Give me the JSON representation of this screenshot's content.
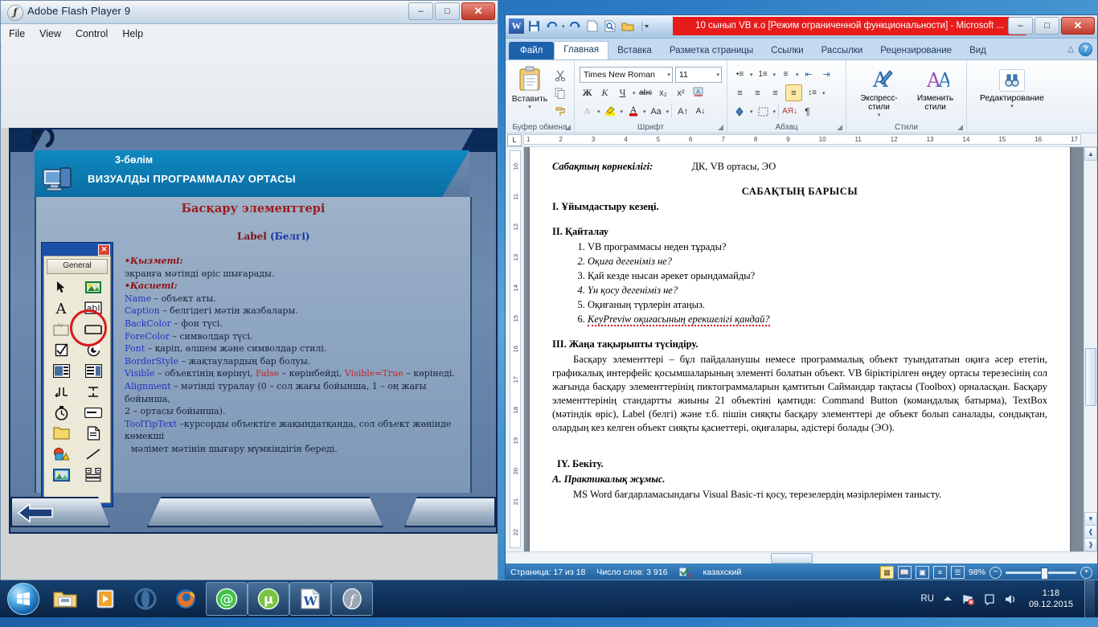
{
  "desktop": {
    "taskbar": {
      "start_label": "start-orb",
      "items": [
        {
          "name": "explorer",
          "label": "Windows Explorer"
        },
        {
          "name": "media-player",
          "label": "Windows Media Player"
        },
        {
          "name": "opera",
          "label": "Opera"
        },
        {
          "name": "firefox",
          "label": "Mozilla Firefox"
        },
        {
          "name": "icq",
          "label": "ICQ"
        },
        {
          "name": "utorrent",
          "label": "uTorrent"
        },
        {
          "name": "word",
          "label": "Microsoft Word"
        },
        {
          "name": "flash",
          "label": "Adobe Flash Player"
        }
      ],
      "tray": {
        "language": "RU",
        "time": "1:18",
        "date": "09.12.2015",
        "icons": [
          "show-hidden-icons",
          "network-error-icon",
          "action-center-icon",
          "volume-icon"
        ]
      }
    }
  },
  "flash": {
    "title": "Adobe Flash Player 9",
    "menu": [
      "File",
      "View",
      "Control",
      "Help"
    ],
    "window_buttons": {
      "minimize": "–",
      "maximize": "□",
      "close": "✕"
    },
    "slide": {
      "header_number": "3-бөлім",
      "header_title": "ВИЗУАЛДЫ ПРОГРАММАЛАУ ОРТАСЫ",
      "title": "Басқару элементтері",
      "subtitle_en": "Label",
      "subtitle_kk": "(Белгі)",
      "toolbox": {
        "tab": "General",
        "close": "✕",
        "tools": [
          "pointer-tool-icon",
          "picturebox-tool-icon",
          "label-tool-icon",
          "textbox-tool-icon",
          "frame-tool-icon",
          "commandbutton-tool-icon",
          "checkbox-tool-icon",
          "optionbutton-tool-icon",
          "combobox-tool-icon",
          "listbox-tool-icon",
          "hscrollbar-tool-icon",
          "vscrollbar-tool-icon",
          "timer-tool-icon",
          "drivelistbox-tool-icon",
          "dirlistbox-tool-icon",
          "filelistbox-tool-icon",
          "shape-tool-icon",
          "line-tool-icon",
          "image-tool-icon",
          "data-tool-icon"
        ]
      },
      "lines": [
        {
          "type": "head",
          "text": "•Қызметі:"
        },
        {
          "type": "plain",
          "text": "экранға мәтінді өріс шығарады."
        },
        {
          "type": "head",
          "text": "•Қасиеті:"
        },
        {
          "type": "prop",
          "prop": "Name",
          "text": "– объект аты."
        },
        {
          "type": "prop",
          "prop": "Caption",
          "text": "– белгідегі мәтін жазбалары."
        },
        {
          "type": "prop",
          "prop": "BackColor",
          "text": "– фон түсі."
        },
        {
          "type": "prop",
          "prop": "ForeColor",
          "text": "– символдар түсі."
        },
        {
          "type": "prop",
          "prop": "Font",
          "text": "– қаріп, өлшем және символдар стилі."
        },
        {
          "type": "prop",
          "prop": "BorderStyle",
          "text": "– жақтаулардың бар болуы."
        }
      ],
      "visible_line": {
        "prop": "Visible",
        "mid": "– объектінің көрінуі,",
        "red1": "False",
        "mid2": "– көрінбейді,",
        "red2": "Visible=True",
        "tail": "– көрінеді."
      },
      "alignment_line": {
        "prop": "Alignment",
        "text": "– мәтінді туралау (0 – сол жағы бойынша, 1 – оң жағы бойынша,",
        "cont": "2 – ортасы бойынша)."
      },
      "tooltip_line": {
        "prop": "ToolTipText",
        "text": "–курсорды объектіге жақындатқанда, сол объект жөнінде көмекші",
        "cont": "мәлімет мәтінін шығару мүмкіндігін береді."
      },
      "back_button": "back-arrow-button",
      "replay_button": "replay-button"
    }
  },
  "word": {
    "title": "10 сынып VB к.о [Режим ограниченной функциональности]  -  Microsoft ...",
    "window_buttons": {
      "minimize": "–",
      "maximize": "□",
      "close": "✕"
    },
    "quick_access": [
      "save-icon",
      "undo-icon",
      "redo-icon",
      "new-icon",
      "print-preview-icon",
      "open-icon",
      "customize-qat-icon"
    ],
    "tabs": [
      {
        "label": "Файл",
        "style": "file"
      },
      {
        "label": "Главная",
        "style": "active"
      },
      {
        "label": "Вставка",
        "style": ""
      },
      {
        "label": "Разметка страницы",
        "style": ""
      },
      {
        "label": "Ссылки",
        "style": ""
      },
      {
        "label": "Рассылки",
        "style": ""
      },
      {
        "label": "Рецензирование",
        "style": ""
      },
      {
        "label": "Вид",
        "style": ""
      }
    ],
    "ribbon": {
      "clipboard": {
        "name": "Буфер обмена",
        "paste": "Вставить",
        "cut": "✂",
        "copy": "⧉",
        "format_painter": "🖌"
      },
      "font": {
        "name": "Шрифт",
        "font_family": "Times New Roman",
        "font_size": "11",
        "bold": "Ж",
        "italic": "К",
        "underline": "Ч",
        "strike": "abc",
        "sub": "x₂",
        "sup": "x²",
        "clear_format": "Ⓐ",
        "text_effects": "A",
        "highlight": "ab",
        "font_color": "A",
        "change_case": "Aa",
        "grow": "A↑",
        "shrink": "A↓"
      },
      "paragraph": {
        "name": "Абзац",
        "bullets": "•≡",
        "numbering": "1≡",
        "multilevel": "≡",
        "dec_indent": "⇤",
        "inc_indent": "⇥",
        "sort": "AЯ↓",
        "marks": "¶",
        "align_left": "≡",
        "align_center": "≡",
        "align_right": "≡",
        "align_justify": "≡",
        "line_spacing": "↕≡",
        "shading": "▤",
        "borders": "▦"
      },
      "styles": {
        "name": "Стили",
        "quick_styles": "Экспресс-стили",
        "change_styles": "Изменить\nстили"
      },
      "editing": {
        "name": "Редактирование",
        "label": "Редактирование"
      }
    },
    "ruler": {
      "corner": "L",
      "horizontal": [
        "1",
        "2",
        "3",
        "4",
        "5",
        "6",
        "7",
        "8",
        "9",
        "10",
        "11",
        "12",
        "13",
        "14",
        "15",
        "16",
        "17"
      ],
      "vertical": [
        "10",
        "11",
        "12",
        "13",
        "14",
        "15",
        "16",
        "17",
        "18",
        "19",
        "20",
        "21",
        "22"
      ]
    },
    "document": {
      "visual_label": "Сабақтың көрнекілігі:",
      "visual_value": "ДК, VB ортасы, ЭО",
      "center_heading": "САБАҚТЫҢ  БАРЫСЫ",
      "section1": "I. Ұйымдастыру кезеңі.",
      "section2": "II. Қайталау",
      "questions": [
        "VB программасы неден тұрады?",
        "Оқиға дегеніміз не?",
        "Қай кезде нысан әрекет орындамайды?",
        "Үн қосу дегеніміз не?",
        "Оқиғаның түрлерін атаңыз.",
        "KeyPreviw оқиғасының ерекшелігі қандай?"
      ],
      "section3": "III. Жаңа тақырыпты түсіндіру.",
      "paragraph": "Басқару элементтері – бұл пайдаланушы немесе программалық объект туындататын оқиға әсер ететін, графикалық интерфейс қосымшаларының элементі болатын объект. VB біріктірілген өңдеу ортасы терезесінің сол жағында басқару элементтерінің пиктограммаларын қамтитын Саймандар тақтасы (Toolbox) орналасқан. Басқару элементтерінің стандартты жиыны 21 объектіні қамтиди: Command Button (командалық батырма), TextBox (мәтіндік өріс), Label (белгі) және т.б. пішін сияқты басқару элементтері де объект болып саналады, сондықтан, олардың кез келген объект сияқты қасиеттері, оқиғалары, әдістері болады (ЭО).",
      "section4": "IY. Бекіту.",
      "section4a": "А. Практикалық жұмыс.",
      "section4a_text": "MS Word бағдарламасындағы Visual Basic-ті қосу, терезелердің мәзірлерімен таныcту."
    },
    "status": {
      "page": "Страница: 17 из 18",
      "words": "Число слов: 3 916",
      "language": "казахский",
      "spell_icon": "spell-check-icon",
      "zoom": "98%",
      "views": [
        "print-layout-view",
        "full-screen-view",
        "web-layout-view",
        "outline-view",
        "draft-view"
      ],
      "zoom_out": "−",
      "zoom_in": "+"
    }
  }
}
